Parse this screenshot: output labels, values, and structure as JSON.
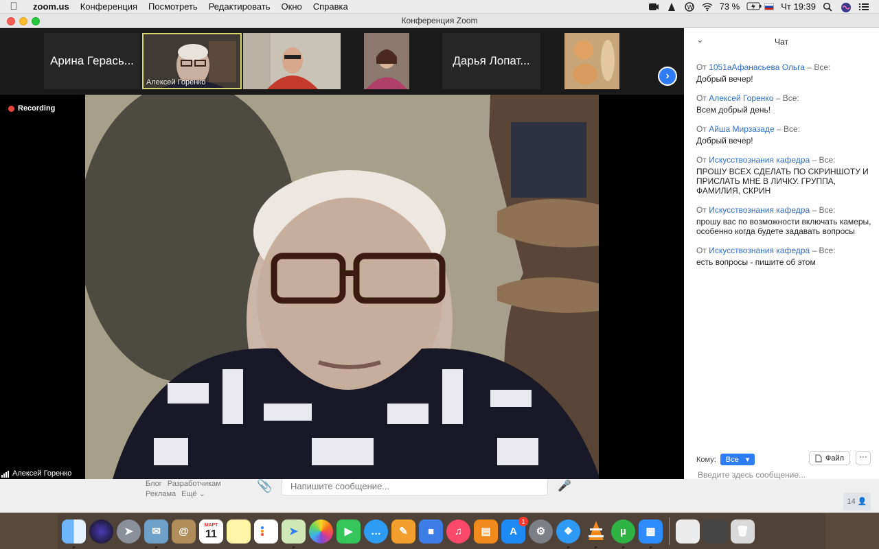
{
  "menubar": {
    "app": "zoom.us",
    "items": [
      "Конференция",
      "Посмотреть",
      "Редактировать",
      "Окно",
      "Справка"
    ],
    "battery": "73 %",
    "clock": "Чт 19:39"
  },
  "window": {
    "title": "Конференция Zoom"
  },
  "gallery": {
    "tiles": [
      {
        "name": "Арина Герась..."
      },
      {
        "label": "Алексей Горенко"
      },
      {
        "label": ""
      },
      {
        "label": ""
      },
      {
        "name": "Дарья Лопат..."
      },
      {
        "label": ""
      }
    ]
  },
  "main": {
    "recording": "Recording",
    "speaker": "Алексей Горенко"
  },
  "chat": {
    "title": "Чат",
    "from_prefix": "От",
    "to_all": "– Все:",
    "messages": [
      {
        "sender": "1051аАфанасьева Ольга",
        "text": "Добрый вечер!"
      },
      {
        "sender": "Алексей Горенко",
        "text": "Всем добрый день!"
      },
      {
        "sender": "Айша Мирзазаде",
        "text": "Добрый вечер!"
      },
      {
        "sender": "Искусствознания кафедра",
        "text": "ПРОШУ ВСЕХ СДЕЛАТЬ ПО СКРИНШОТУ И ПРИСЛАТЬ МНЕ В ЛИЧКУ. ГРУППА, ФАМИЛИЯ, СКРИН"
      },
      {
        "sender": "Искусствознания кафедра",
        "text": "прошу вас по возможности включать камеры, особенно когда будете задавать вопросы"
      },
      {
        "sender": "Искусствознания кафедра",
        "text": "есть вопросы - пишите об этом"
      }
    ],
    "to_label": "Кому:",
    "to_value": "Все",
    "file_label": "Файл",
    "more_label": "···",
    "input_placeholder": "Введите здесь сообщение..."
  },
  "background_page": {
    "links_row1": [
      "Блог",
      "Разработчикам"
    ],
    "links_row2": [
      "Реклама",
      "Ещё ⌄"
    ],
    "message_placeholder": "Напишите сообщение...",
    "online_count": "14"
  },
  "dock": {
    "calendar_month": "МАРТ",
    "calendar_day": "11",
    "appstore_badge": "1",
    "apps": [
      "finder-icon",
      "siri-icon",
      "launchpad-icon",
      "mail-icon",
      "contacts-icon",
      "calendar-icon",
      "notes-icon",
      "reminders-icon",
      "maps-icon",
      "photos-icon",
      "facetime-icon",
      "messages-icon",
      "pages-icon",
      "keynote-icon",
      "music-icon",
      "books-icon",
      "appstore-icon",
      "system-preferences-icon",
      "safari-icon",
      "vlc-icon",
      "utorrent-icon",
      "zoom-icon"
    ]
  }
}
